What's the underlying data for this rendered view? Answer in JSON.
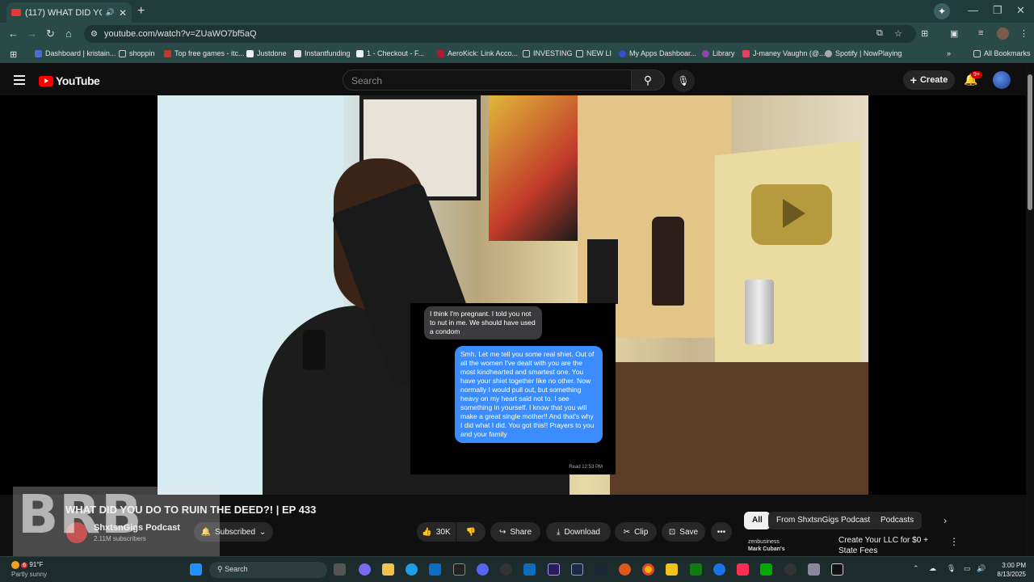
{
  "browser": {
    "tab_title": "(117) WHAT DID YOU DO T",
    "tab_close": "✕",
    "new_tab": "+",
    "url": "youtube.com/watch?v=ZUaWO7bf5aQ",
    "bookmarks": [
      "Dashboard | kristain...",
      "shoppin",
      "Top free games - itc...",
      "Justdone",
      "Instantfunding",
      "1 - Checkout - F...",
      "AeroKick: Link Acco...",
      "INVESTING",
      "NEW LI",
      "My Apps Dashboar...",
      "Library",
      "J-maney Vaughn (@...",
      "Spotify | NowPlaying"
    ],
    "all_bookmarks": "All Bookmarks"
  },
  "youtube": {
    "logo_text": "YouTube",
    "search_placeholder": "Search",
    "create_label": "Create",
    "notif_count": "9+"
  },
  "video": {
    "chat_incoming": "I think I'm pregnant. I told you not to nut in me. We should have used a condom",
    "chat_outgoing": "Smh. Let me tell you some real shiet. Out of all the women I've dealt with you are the most kindhearted and smartest one. You have your shiet together like no other. Now normally I would pull out, but something heavy on my heart said not to. I see something in yourself. I know that you will make a great single mother!! And that's why I did what I did. You got this!! Prayers to you and your family",
    "read_receipt": "Read 12:53 PM",
    "title": "WHAT DID YOU DO TO RUIN THE DEED?! | EP 433"
  },
  "overlay": {
    "brb": "BRB"
  },
  "channel": {
    "name": "ShxtsnGigs Podcast",
    "subs": "2.11M subscribers",
    "subscribed_label": "Subscribed"
  },
  "actions": {
    "likes": "30K",
    "share": "Share",
    "download": "Download",
    "clip": "Clip",
    "save": "Save",
    "more": "•••"
  },
  "chips": [
    "All",
    "From ShxtsnGigs Podcast",
    "Podcasts"
  ],
  "ad": {
    "brand": "zenbusiness",
    "subtitle": "Mark Cuban's",
    "title": "Create Your LLC for $0 + State Fees"
  },
  "taskbar": {
    "weather_temp": "91°F",
    "weather_desc": "Partly sunny",
    "weather_badge": "6",
    "search": "Search",
    "time": "3:00 PM",
    "date": "8/13/2025"
  }
}
